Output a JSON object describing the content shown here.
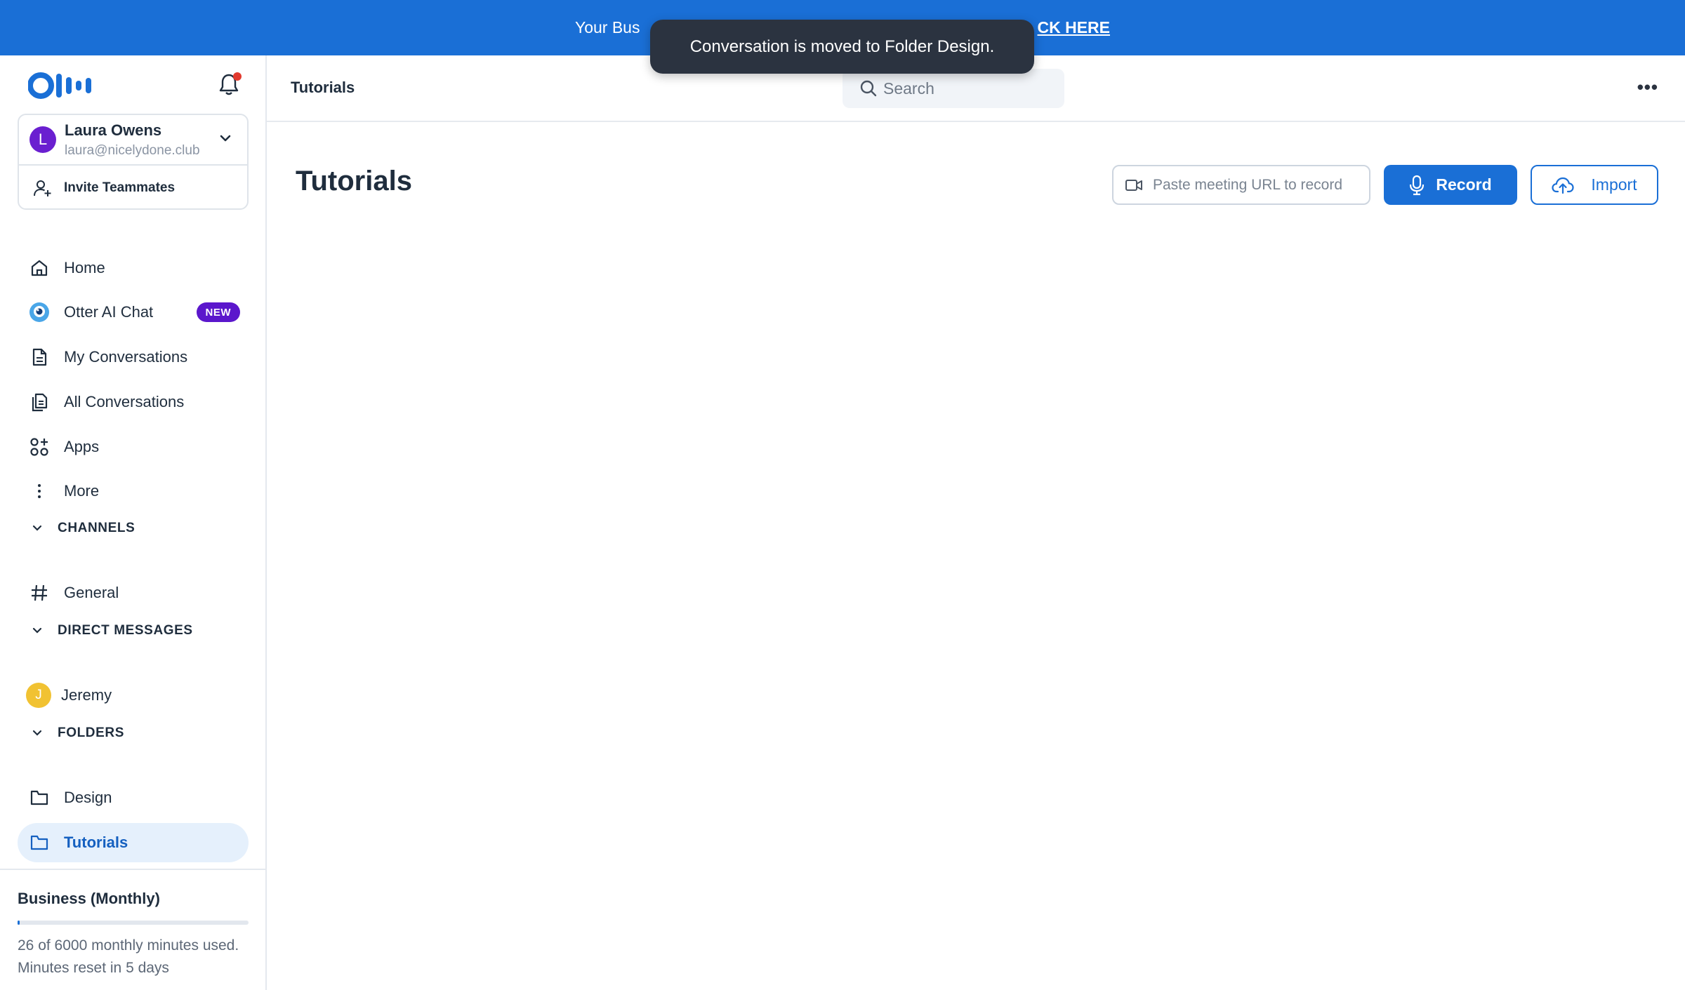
{
  "banner": {
    "text": "Your Bus",
    "link_text": "CK HERE"
  },
  "toast": {
    "message": "Conversation is moved to Folder Design."
  },
  "sidebar": {
    "account": {
      "avatar_letter": "L",
      "name": "Laura Owens",
      "email": "laura@nicelydone.club"
    },
    "invite_label": "Invite Teammates",
    "nav": [
      {
        "label": "Home",
        "icon": "home-icon"
      },
      {
        "label": "Otter AI Chat",
        "icon": "otter-chat-icon",
        "badge": "NEW"
      },
      {
        "label": "My Conversations",
        "icon": "document-icon"
      },
      {
        "label": "All Conversations",
        "icon": "documents-icon"
      },
      {
        "label": "Apps",
        "icon": "apps-icon"
      },
      {
        "label": "More",
        "icon": "vertical-dots-icon"
      }
    ],
    "channels": {
      "heading": "CHANNELS",
      "items": [
        {
          "label": "General",
          "icon": "hash-icon"
        }
      ]
    },
    "direct_messages": {
      "heading": "DIRECT MESSAGES",
      "items": [
        {
          "label": "Jeremy",
          "avatar_letter": "J"
        }
      ]
    },
    "folders": {
      "heading": "FOLDERS",
      "items": [
        {
          "label": "Design",
          "icon": "folder-icon",
          "active": false
        },
        {
          "label": "Tutorials",
          "icon": "folder-icon",
          "active": true
        }
      ]
    },
    "plan": {
      "title": "Business (Monthly)",
      "usage_text": "26 of 6000 monthly minutes used. Minutes reset in 5 days",
      "used_minutes": 26,
      "total_minutes": 6000
    }
  },
  "topbar": {
    "breadcrumb": "Tutorials",
    "search_placeholder": "Search"
  },
  "main": {
    "title": "Tutorials",
    "url_placeholder": "Paste meeting URL to record",
    "record_label": "Record",
    "import_label": "Import"
  },
  "colors": {
    "brand_blue": "#1a6fd6",
    "new_badge": "#5b17cc",
    "active_bg": "#e5f0fc",
    "notification_dot": "#e23a2e"
  }
}
